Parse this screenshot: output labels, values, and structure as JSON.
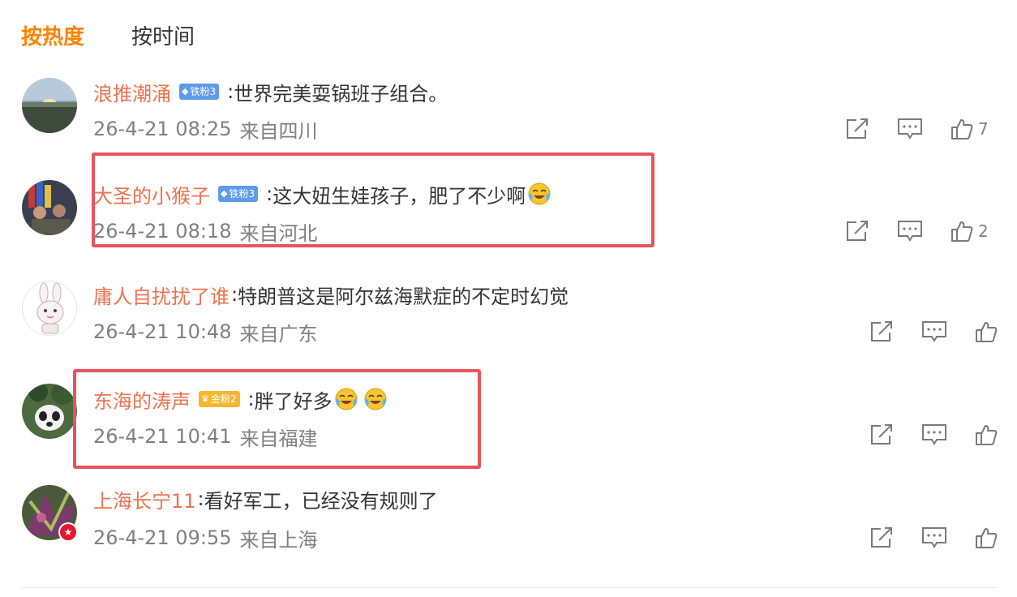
{
  "tabs": [
    {
      "label": "按热度",
      "active": true
    },
    {
      "label": "按时间",
      "active": false
    }
  ],
  "comments": [
    {
      "username": "浪推潮涌",
      "badge": {
        "type": "iron",
        "label": "铁粉3"
      },
      "separator": ":",
      "text": "世界完美耍锅班子组合。",
      "emojis": [],
      "timestamp": "26-4-21 08:25",
      "source": "来自四川",
      "likes": "7",
      "highlighted": false
    },
    {
      "username": "大圣的小猴子",
      "badge": {
        "type": "iron",
        "label": "铁粉3"
      },
      "separator": ":",
      "text": "这大妞生娃孩子，肥了不少啊",
      "emojis": [
        "laugh-cry-emoji"
      ],
      "timestamp": "26-4-21 08:18",
      "source": "来自河北",
      "likes": "2",
      "highlighted": true
    },
    {
      "username": "庸人自扰扰了谁",
      "badge": null,
      "separator": ":",
      "text": "特朗普这是阿尔兹海默症的不定时幻觉",
      "emojis": [],
      "timestamp": "26-4-21 10:48",
      "source": "来自广东",
      "likes": "",
      "highlighted": false
    },
    {
      "username": "东海的涛声",
      "badge": {
        "type": "gold",
        "label": "金粉2"
      },
      "separator": ":",
      "text": "胖了好多",
      "emojis": [
        "laugh-cry-emoji",
        "laugh-cry-emoji"
      ],
      "timestamp": "26-4-21 10:41",
      "source": "来自福建",
      "likes": "",
      "highlighted": true
    },
    {
      "username": "上海长宁11",
      "badge": null,
      "separator": ":",
      "text": "看好军工，已经没有规则了",
      "emojis": [],
      "timestamp": "26-4-21 09:55",
      "source": "来自上海",
      "likes": "",
      "highlighted": false
    }
  ],
  "icons": {
    "share": "share-icon",
    "reply": "comment-icon",
    "like": "thumbs-up-icon",
    "verified": "verified-badge-icon"
  },
  "colors": {
    "active_tab": "#ff8200",
    "username": "#eb7350",
    "meta_text": "#808080",
    "iron_badge": "#5e9ce8",
    "gold_badge": "#f5b731",
    "highlight_box": "#e8545c"
  }
}
